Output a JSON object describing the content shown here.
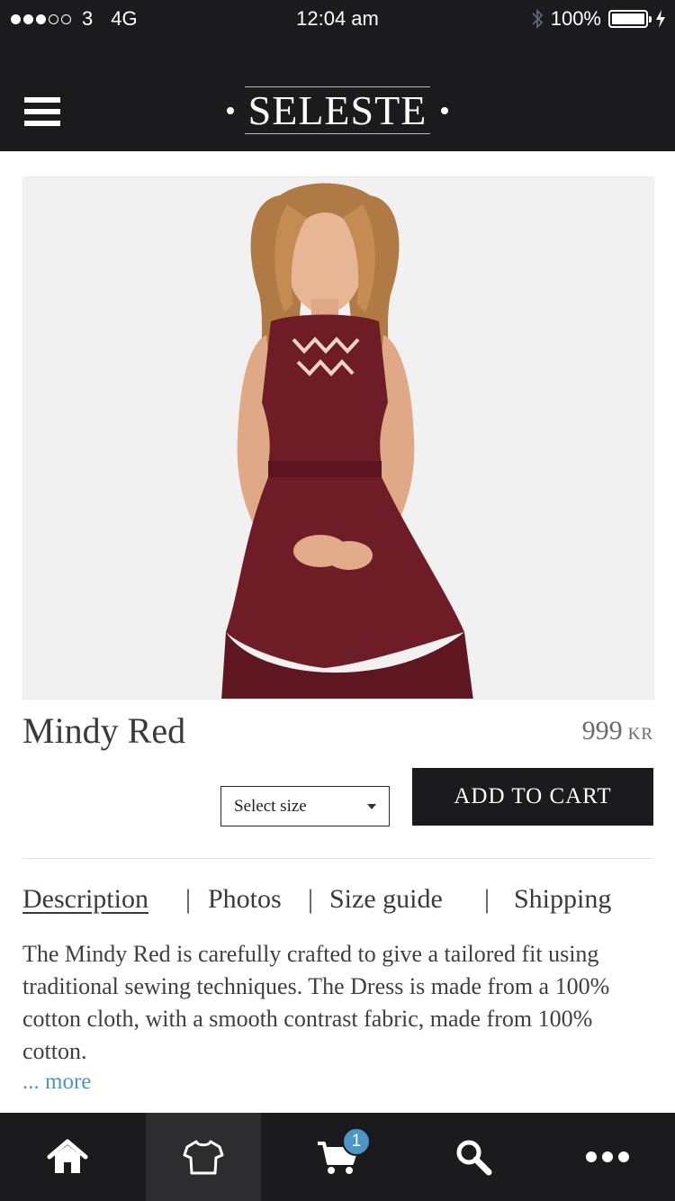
{
  "status_bar": {
    "carrier": "3",
    "network": "4G",
    "time": "12:04 am",
    "battery": "100%",
    "battery_level": 1.0,
    "signal_strength": 3
  },
  "header": {
    "brand": "SELESTE"
  },
  "product": {
    "name": "Mindy Red",
    "price": "999",
    "currency": "KR",
    "dress_color": "#6e1c26",
    "image_background": "#f1f1f1"
  },
  "actions": {
    "size_select": "Select size",
    "add_to_cart": "ADD TO CART"
  },
  "tabs": [
    {
      "label": "Description",
      "active": true
    },
    {
      "label": "Photos",
      "active": false
    },
    {
      "label": "Size guide",
      "active": false
    },
    {
      "label": "Shipping",
      "active": false
    }
  ],
  "tab_separator": "|",
  "description": "The Mindy Red is carefully crafted to give a tailored fit using traditional sewing techniques. The Dress is made from a 100% cotton  cloth, with a smooth contrast fabric, made from 100% cotton.",
  "more_link": "... more",
  "tab_bar": {
    "items": [
      {
        "icon": "home-icon",
        "active": false
      },
      {
        "icon": "shirt-icon",
        "active": true
      },
      {
        "icon": "cart-icon",
        "active": false
      },
      {
        "icon": "search-icon",
        "active": false
      },
      {
        "icon": "more-icon",
        "active": false
      }
    ],
    "cart_count": "1"
  },
  "colors": {
    "dark": "#1b1b1d",
    "accent": "#4a96c8"
  }
}
